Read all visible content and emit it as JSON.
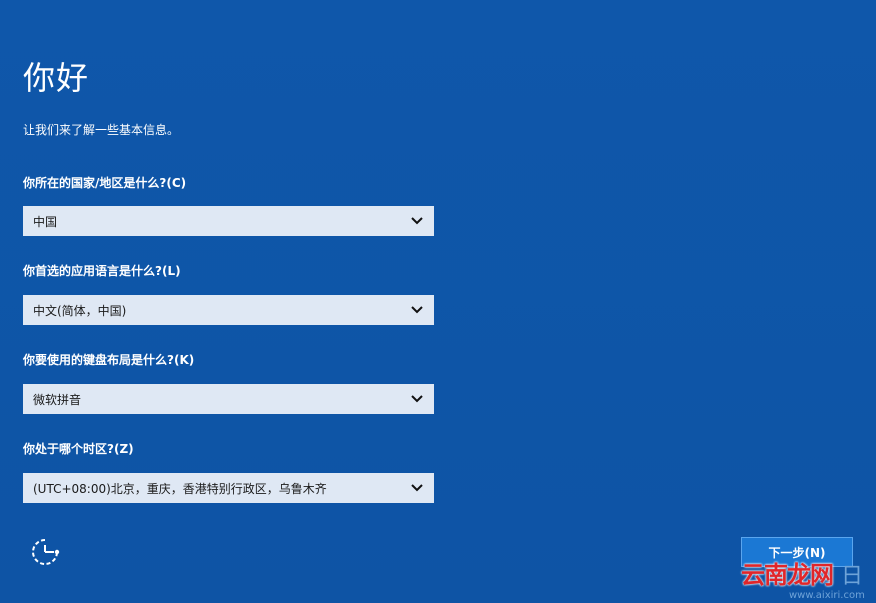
{
  "header": {
    "title": "你好",
    "subtitle": "让我们来了解一些基本信息。"
  },
  "fields": [
    {
      "label": "你所在的国家/地区是什么?(C)",
      "value": "中国",
      "icon": "chevron-down-icon"
    },
    {
      "label": "你首选的应用语言是什么?(L)",
      "value": "中文(简体，中国)",
      "icon": "chevron-down-icon"
    },
    {
      "label": "你要使用的键盘布局是什么?(K)",
      "value": "微软拼音",
      "icon": "chevron-down-icon"
    },
    {
      "label": "你处于哪个时区?(Z)",
      "value": "(UTC+08:00)北京，重庆，香港特别行政区，乌鲁木齐",
      "icon": "chevron-down-icon"
    }
  ],
  "footer": {
    "ease_of_access_icon": "ease-of-access-icon",
    "next_label": "下一步(N)"
  },
  "watermark": {
    "brand": "云南龙网",
    "side_char": "日",
    "url": "www.aixiri.com"
  },
  "colors": {
    "background": "#0f56a8",
    "select_bg": "#dfe8f4",
    "button_bg": "#1b78d4",
    "watermark_red": "#e0262a"
  }
}
